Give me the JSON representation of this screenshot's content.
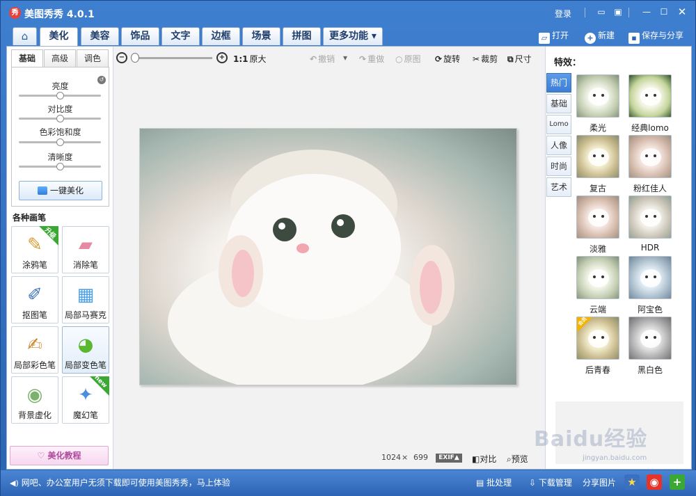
{
  "window": {
    "title": "美图秀秀 4.0.1",
    "logo_char": "秀",
    "login": "登录"
  },
  "main_tabs": [
    "美化",
    "美容",
    "饰品",
    "文字",
    "边框",
    "场景",
    "拼图",
    "更多功能 ▾"
  ],
  "top_actions": {
    "open": "打开",
    "new": "新建",
    "save_share": "保存与分享"
  },
  "left_panel": {
    "subtabs": [
      "基础",
      "高级",
      "调色"
    ],
    "sliders": [
      {
        "label": "亮度",
        "value": 0.5
      },
      {
        "label": "对比度",
        "value": 0.5
      },
      {
        "label": "色彩饱和度",
        "value": 0.5
      },
      {
        "label": "清晰度",
        "value": 0.5
      }
    ],
    "one_click": "一键美化",
    "brushes_title": "各种画笔",
    "tools": [
      {
        "label": "涂鸦笔",
        "badge": "升级"
      },
      {
        "label": "消除笔"
      },
      {
        "label": "抠图笔"
      },
      {
        "label": "局部马赛克"
      },
      {
        "label": "局部彩色笔"
      },
      {
        "label": "局部变色笔"
      },
      {
        "label": "背景虚化"
      },
      {
        "label": "魔幻笔",
        "badge": "new"
      }
    ],
    "tutorial": "美化教程"
  },
  "toolbar": {
    "zoom_minus": "−",
    "zoom_plus": "+",
    "ratio": "1:1",
    "original_size": "原大",
    "undo": "撤销",
    "redo": "重做",
    "original": "原图",
    "rotate": "旋转",
    "crop": "裁剪",
    "resize": "尺寸"
  },
  "canvas": {
    "width": "1024",
    "times": "×",
    "height": "699",
    "exif": "EXIF▲",
    "compare": "对比",
    "preview": "预览"
  },
  "right_panel": {
    "title": "特效：",
    "categories": [
      "热门",
      "基础",
      "Lomo",
      "人像",
      "时尚",
      "艺术"
    ],
    "effects": [
      "柔光",
      "经典lomo",
      "复古",
      "粉红佳人",
      "淡雅",
      "HDR",
      "云端",
      "阿宝色",
      "后青春",
      "黑白色"
    ],
    "vip_badge": "会员"
  },
  "statusbar": {
    "tip": "网吧、办公室用户无须下载即可使用美图秀秀，马上体验",
    "batch": "批处理",
    "download": "下载管理",
    "share_pic": "分享图片"
  },
  "watermark": {
    "brand": "Baidu经验",
    "url": "jingyan.baidu.com"
  }
}
